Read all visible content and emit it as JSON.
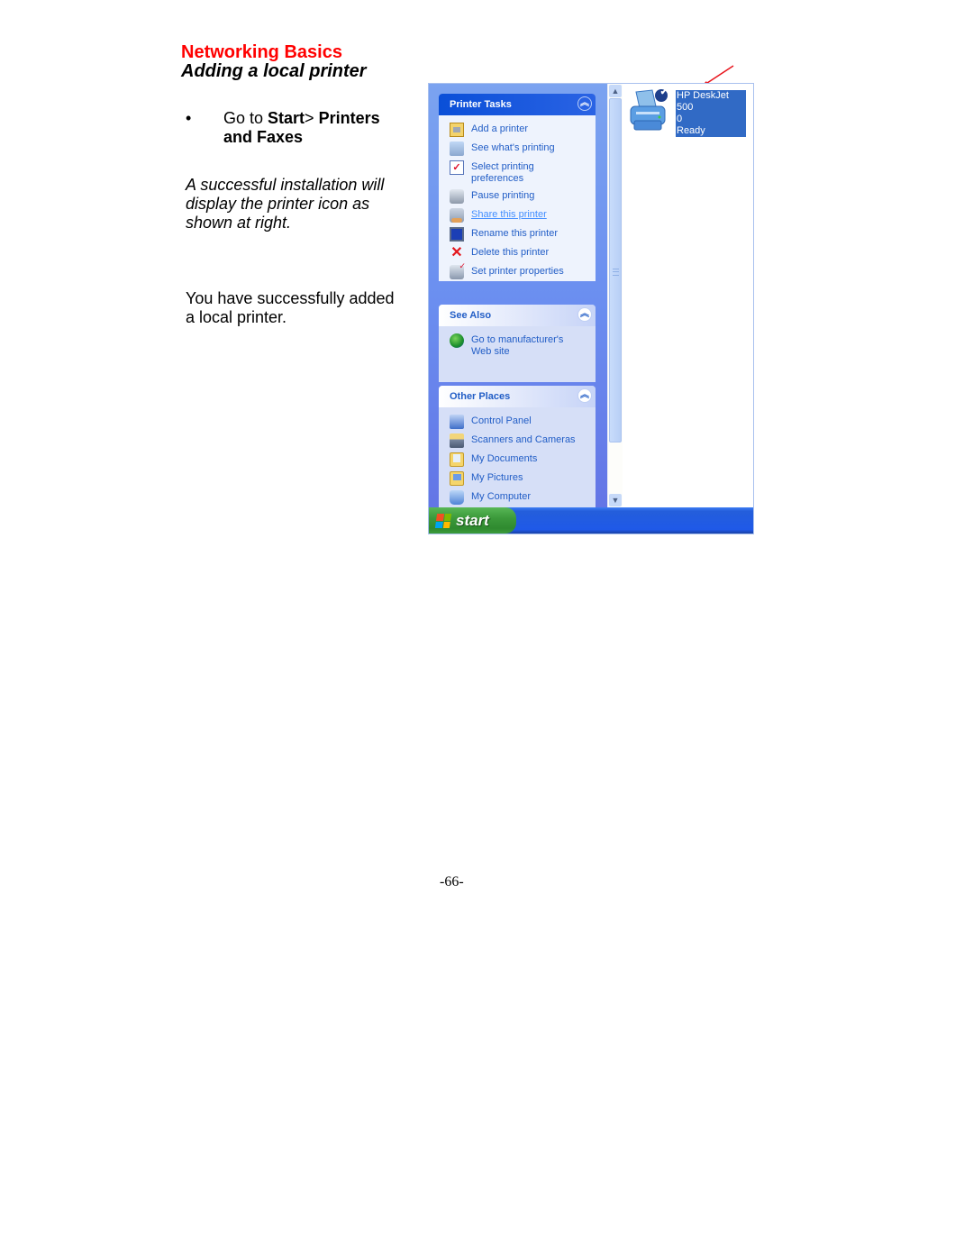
{
  "document": {
    "title": "Networking Basics",
    "subtitle": "Adding a local printer",
    "bullet": {
      "marker": "•",
      "prefix": "Go to ",
      "start": "Start",
      "separator": "> ",
      "printers_and_faxes": "Printers and Faxes"
    },
    "note": "A successful installation will display the printer icon as shown at right.",
    "conclusion": "You have successfully added a local printer.",
    "page_number": "-66-"
  },
  "screenshot": {
    "printer_tasks": {
      "title": "Printer Tasks",
      "collapse_icon": "double-chevron-up-icon",
      "items": [
        {
          "label": "Add a printer",
          "icon": "add-printer-icon"
        },
        {
          "label": "See what's printing",
          "icon": "print-queue-icon"
        },
        {
          "label": "Select printing preferences",
          "icon": "preferences-icon"
        },
        {
          "label": "Pause printing",
          "icon": "pause-printer-icon"
        },
        {
          "label": "Share this printer",
          "icon": "share-printer-icon"
        },
        {
          "label": "Rename this printer",
          "icon": "rename-icon"
        },
        {
          "label": "Delete this printer",
          "icon": "delete-icon"
        },
        {
          "label": "Set printer properties",
          "icon": "printer-properties-icon"
        }
      ]
    },
    "see_also": {
      "title": "See Also",
      "items": [
        {
          "label": "Go to manufacturer's Web site",
          "icon": "globe-icon"
        }
      ]
    },
    "other_places": {
      "title": "Other Places",
      "items": [
        {
          "label": "Control Panel",
          "icon": "control-panel-icon"
        },
        {
          "label": "Scanners and Cameras",
          "icon": "scanner-icon"
        },
        {
          "label": "My Documents",
          "icon": "my-documents-icon"
        },
        {
          "label": "My Pictures",
          "icon": "my-pictures-icon"
        },
        {
          "label": "My Computer",
          "icon": "my-computer-icon"
        }
      ]
    },
    "printer": {
      "name_line1": "HP DeskJet 500",
      "name_line2": "0",
      "status": "Ready",
      "default_check": "✔"
    },
    "scrollbar": {
      "up": "▲",
      "down": "▼"
    },
    "taskbar": {
      "start_label": "start"
    },
    "glyphs": {
      "collapse": "︽",
      "delete": "✕",
      "check": "✓"
    },
    "colors": {
      "heading_red": "#ff0000",
      "link_blue": "#215dc6",
      "selection_blue": "#316ac5",
      "taskbar_blue": "#245edb",
      "start_green": "#3c9a3b"
    }
  }
}
